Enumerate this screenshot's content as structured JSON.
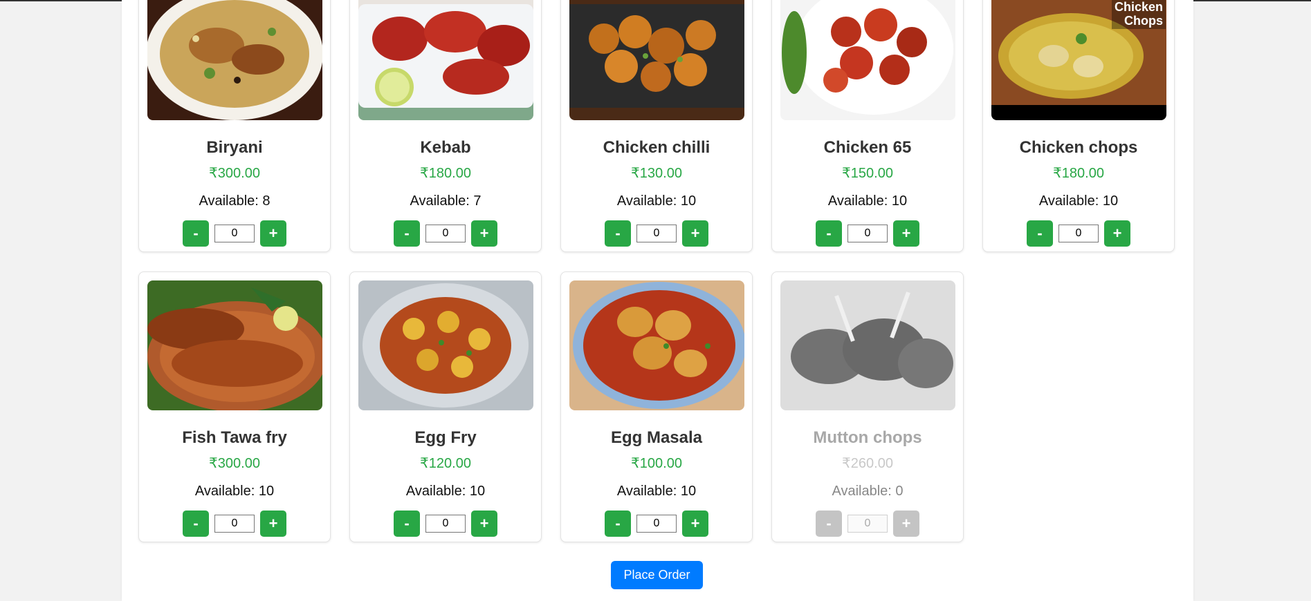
{
  "menu": {
    "items": [
      {
        "name": "Biryani",
        "price": "₹300.00",
        "available": "Available: 8",
        "qty": "0",
        "disabled": false,
        "image": "biryani-image"
      },
      {
        "name": "Kebab",
        "price": "₹180.00",
        "available": "Available: 7",
        "qty": "0",
        "disabled": false,
        "image": "kebab-image"
      },
      {
        "name": "Chicken chilli",
        "price": "₹130.00",
        "available": "Available: 10",
        "qty": "0",
        "disabled": false,
        "image": "chicken-chilli-image"
      },
      {
        "name": "Chicken 65",
        "price": "₹150.00",
        "available": "Available: 10",
        "qty": "0",
        "disabled": false,
        "image": "chicken-65-image"
      },
      {
        "name": "Chicken chops",
        "price": "₹180.00",
        "available": "Available: 10",
        "qty": "0",
        "disabled": false,
        "image": "chicken-chops-image",
        "image_caption": "Chicken Chops"
      },
      {
        "name": "Fish Tawa fry",
        "price": "₹300.00",
        "available": "Available: 10",
        "qty": "0",
        "disabled": false,
        "image": "fish-tawa-fry-image"
      },
      {
        "name": "Egg Fry",
        "price": "₹120.00",
        "available": "Available: 10",
        "qty": "0",
        "disabled": false,
        "image": "egg-fry-image"
      },
      {
        "name": "Egg Masala",
        "price": "₹100.00",
        "available": "Available: 10",
        "qty": "0",
        "disabled": false,
        "image": "egg-masala-image"
      },
      {
        "name": "Mutton chops",
        "price": "₹260.00",
        "available": "Available: 0",
        "qty": "0",
        "disabled": true,
        "image": "mutton-chops-image"
      }
    ],
    "minus_label": "-",
    "plus_label": "+"
  },
  "actions": {
    "place_order_label": "Place Order"
  },
  "colors": {
    "price": "#28a745",
    "button": "#28a745",
    "primary": "#007bff",
    "disabled": "#c4c4c4"
  }
}
